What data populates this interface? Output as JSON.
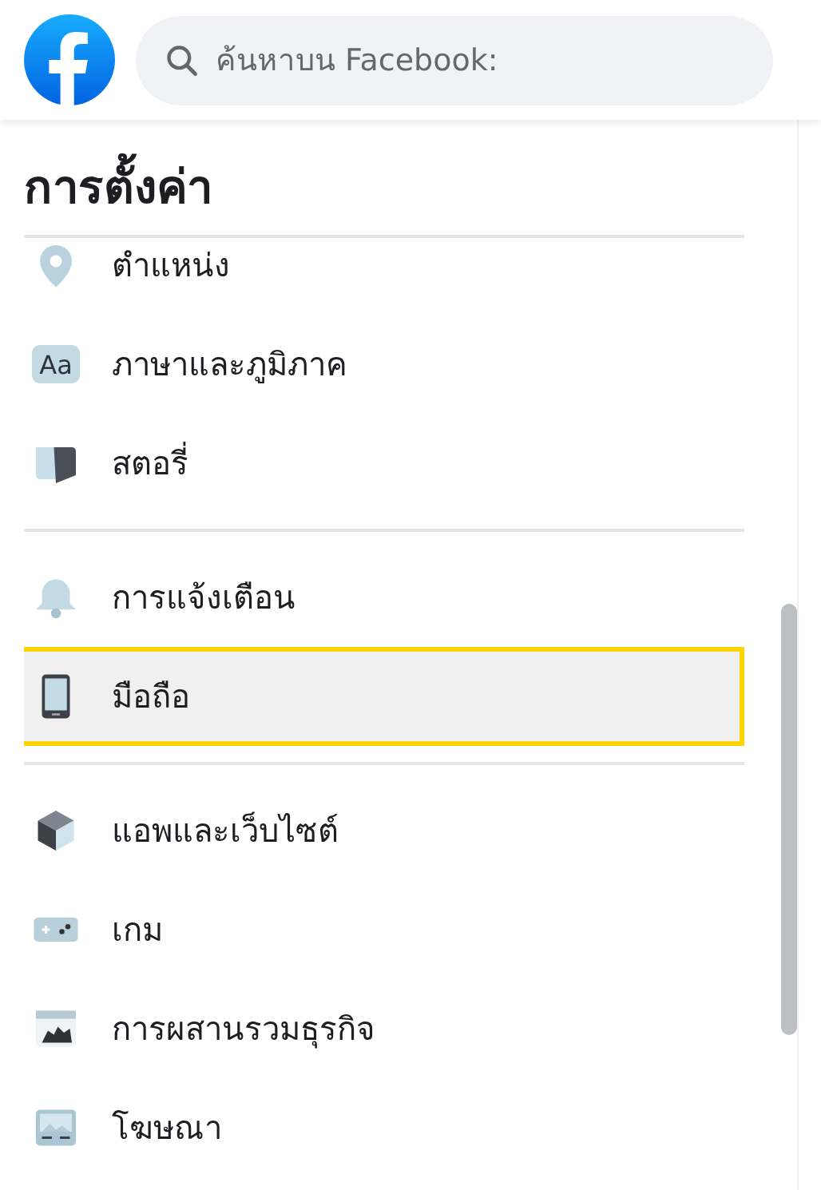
{
  "search": {
    "placeholder": "ค้นหาบน Facebook:"
  },
  "title": "การตั้งค่า",
  "sections": [
    {
      "items": [
        {
          "kind": "location",
          "label": "ตำแหน่ง",
          "selected": false
        },
        {
          "kind": "language",
          "icon_text": "Aa",
          "label": "ภาษาและภูมิภาค",
          "selected": false
        },
        {
          "kind": "story",
          "label": "สตอรี่",
          "selected": false
        }
      ]
    },
    {
      "items": [
        {
          "kind": "notification",
          "label": "การแจ้งเตือน",
          "selected": false
        },
        {
          "kind": "mobile",
          "label": "มือถือ",
          "selected": true
        }
      ]
    },
    {
      "items": [
        {
          "kind": "apps",
          "label": "แอพและเว็บไซต์",
          "selected": false
        },
        {
          "kind": "games",
          "label": "เกม",
          "selected": false
        },
        {
          "kind": "business",
          "label": "การผสานรวมธุรกิจ",
          "selected": false
        },
        {
          "kind": "ads",
          "label": "โฆษณา",
          "selected": false
        }
      ]
    }
  ]
}
